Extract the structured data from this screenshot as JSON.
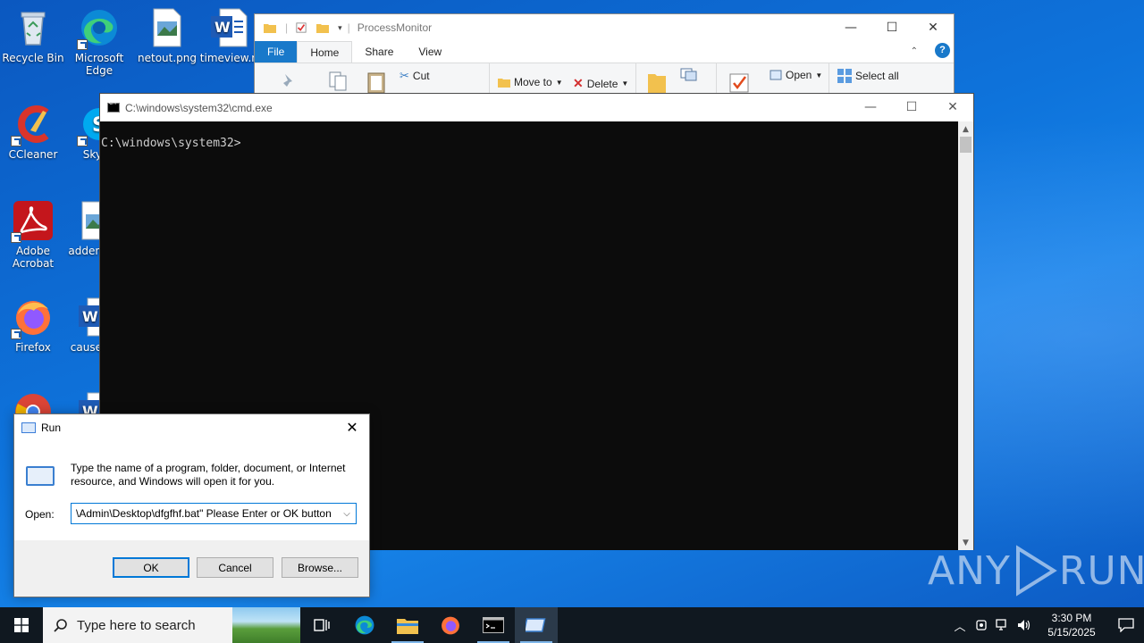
{
  "desktop": {
    "icons": [
      {
        "label": "Recycle Bin"
      },
      {
        "label": "Microsoft Edge"
      },
      {
        "label": "netout.png"
      },
      {
        "label": "timeview.r"
      },
      {
        "label": "CCleaner"
      },
      {
        "label": "Sky"
      },
      {
        "label": "Adobe Acrobat"
      },
      {
        "label": "adden"
      },
      {
        "label": "Firefox"
      },
      {
        "label": "cause"
      }
    ]
  },
  "explorer": {
    "title": "ProcessMonitor",
    "tabs": [
      "File",
      "Home",
      "Share",
      "View"
    ],
    "ribbon": {
      "cut": "Cut",
      "move_to": "Move to",
      "delete": "Delete",
      "open": "Open",
      "select_all": "Select all"
    }
  },
  "cmd": {
    "title": "C:\\windows\\system32\\cmd.exe",
    "prompt": "C:\\windows\\system32>"
  },
  "run_dialog": {
    "title": "Run",
    "description": "Type the name of a program, folder, document, or Internet resource, and Windows will open it for you.",
    "open_label": "Open:",
    "open_value": "\\Admin\\Desktop\\dfgfhf.bat\" Please Enter or OK button",
    "ok_label": "OK",
    "cancel_label": "Cancel",
    "browse_label": "Browse..."
  },
  "watermark": {
    "left": "ANY",
    "right": "RUN"
  },
  "taskbar": {
    "search_placeholder": "Type here to search",
    "time": "3:30 PM",
    "date": "5/15/2025"
  },
  "colors": {
    "accent": "#0078d7",
    "file_tab": "#1979ca",
    "cmd_bg": "#0c0c0c",
    "taskbar": "#101820"
  }
}
